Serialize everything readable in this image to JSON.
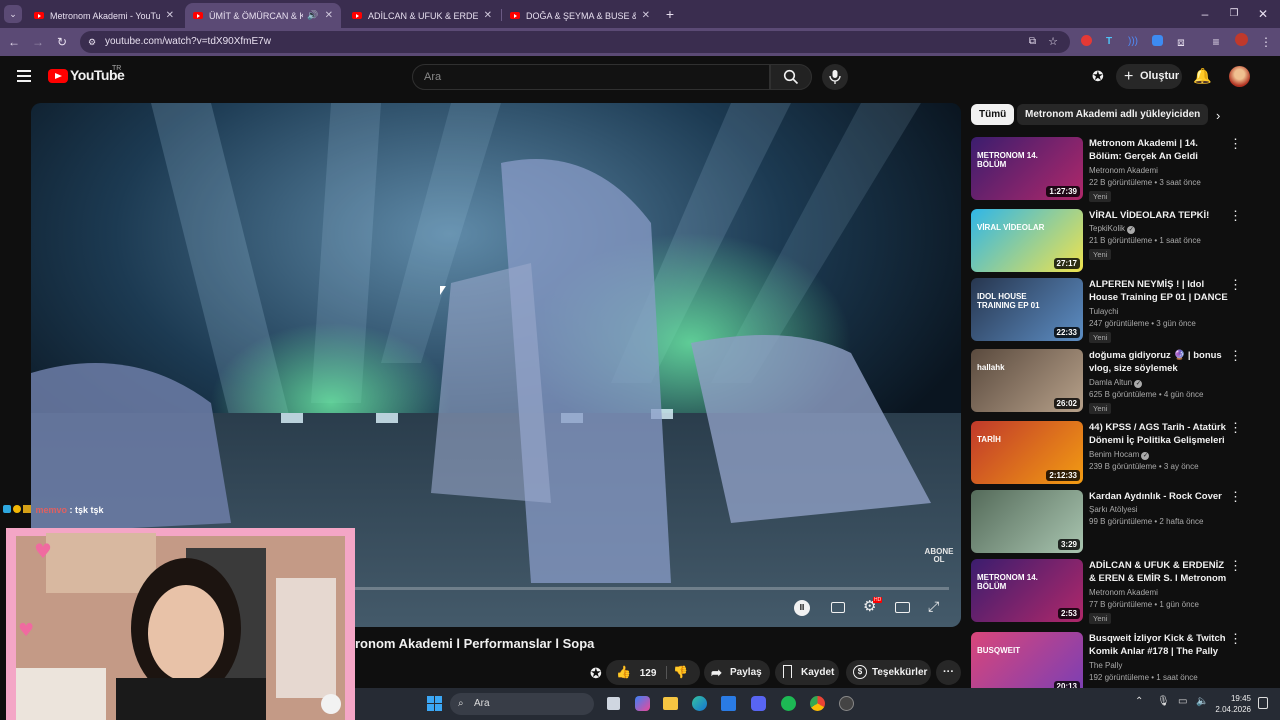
{
  "browser": {
    "tabs": [
      {
        "title": "Metronom Akademi - YouTube",
        "active": false
      },
      {
        "title": "ÜMİT & ÖMÜRCAN & KAA",
        "active": true
      },
      {
        "title": "ADİLCAN & UFUK & ERDENİZ &",
        "active": false
      },
      {
        "title": "DOĞA & ŞEYMA & BUSE & GÜ",
        "active": false
      }
    ],
    "url": "youtube.com/watch?v=tdX90XfmE7w",
    "new_tab": "+"
  },
  "youtube": {
    "logo_text": "YouTube",
    "logo_region": "TR",
    "search_placeholder": "Ara",
    "create_label": "Oluştur"
  },
  "player": {
    "overlay_text": "ABONE OL",
    "progress": 0.0
  },
  "video": {
    "title_visible": "ronom Akademi l Performanslar l Sopa",
    "likes": "129",
    "share_label": "Paylaş",
    "save_label": "Kaydet",
    "thanks_label": "Teşekkürler",
    "more": "···"
  },
  "chat": {
    "user": "memvo",
    "message": ": tşk tşk"
  },
  "sidebar": {
    "chips": [
      "Tümü",
      "Metronom Akademi adlı yükleyiciden"
    ],
    "items": [
      {
        "title": "Metronom Akademi | 14. Bölüm: Gerçek An Geldi",
        "channel": "Metronom Akademi",
        "meta": "22 B görüntüleme • 3 saat önce",
        "badge": "Yeni",
        "duration": "1:27:39",
        "verified": false
      },
      {
        "title": "VİRAL VİDEOLARA TEPKİ!",
        "channel": "TepkiKolik",
        "meta": "21 B görüntüleme • 1 saat önce",
        "badge": "Yeni",
        "duration": "27:17",
        "verified": true
      },
      {
        "title": "ALPEREN NEYMİŞ ! | Idol House Training EP 01 | DANCE ...",
        "channel": "Tulaychi",
        "meta": "247 görüntüleme • 3 gün önce",
        "badge": "Yeni",
        "duration": "22:33",
        "verified": false
      },
      {
        "title": "doğuma gidiyoruz 🔮 | bonus vlog, size söylemek istedikleri...",
        "channel": "Damla Altun",
        "meta": "625 B görüntüleme • 4 gün önce",
        "badge": "Yeni",
        "duration": "26:02",
        "verified": true
      },
      {
        "title": "44) KPSS / AGS Tarih - Atatürk Dönemi İç Politika Gelişmeleri ...",
        "channel": "Benim Hocam",
        "meta": "239 B görüntüleme • 3 ay önce",
        "badge": "",
        "duration": "2:12:33",
        "verified": true
      },
      {
        "title": "Kardan Aydınlık - Rock Cover",
        "channel": "Şarkı Atölyesi",
        "meta": "99 B görüntüleme • 2 hafta önce",
        "badge": "",
        "duration": "3:29",
        "verified": false
      },
      {
        "title": "ADİLCAN & UFUK & ERDENİZ & EREN & EMİR S. l Metronom ...",
        "channel": "Metronom Akademi",
        "meta": "77 B görüntüleme • 1 gün önce",
        "badge": "Yeni",
        "duration": "2:53",
        "verified": false
      },
      {
        "title": "Busqweit İzliyor Kick & Twitch Komik Anlar #178 | The Pally",
        "channel": "The Pally",
        "meta": "192 görüntüleme • 1 saat önce",
        "badge": "",
        "duration": "20:13",
        "verified": false
      }
    ],
    "thumb_texts": [
      "METRONOM 14. BÖLÜM",
      "VİRAL VİDEOLAR",
      "IDOL HOUSE TRAINING EP 01",
      "hallahk",
      "TARİH",
      "",
      "METRONOM 14. BÖLÜM",
      "BUSQWEIT"
    ]
  },
  "taskbar": {
    "search_label": "Ara",
    "time": "19:45",
    "date": "2.04.2026"
  },
  "colors": {
    "browser_frame": "#3a2d4f",
    "browser_active": "#5b4a75",
    "yt_red": "#ff0000",
    "page_bg": "#0f0f0f"
  }
}
